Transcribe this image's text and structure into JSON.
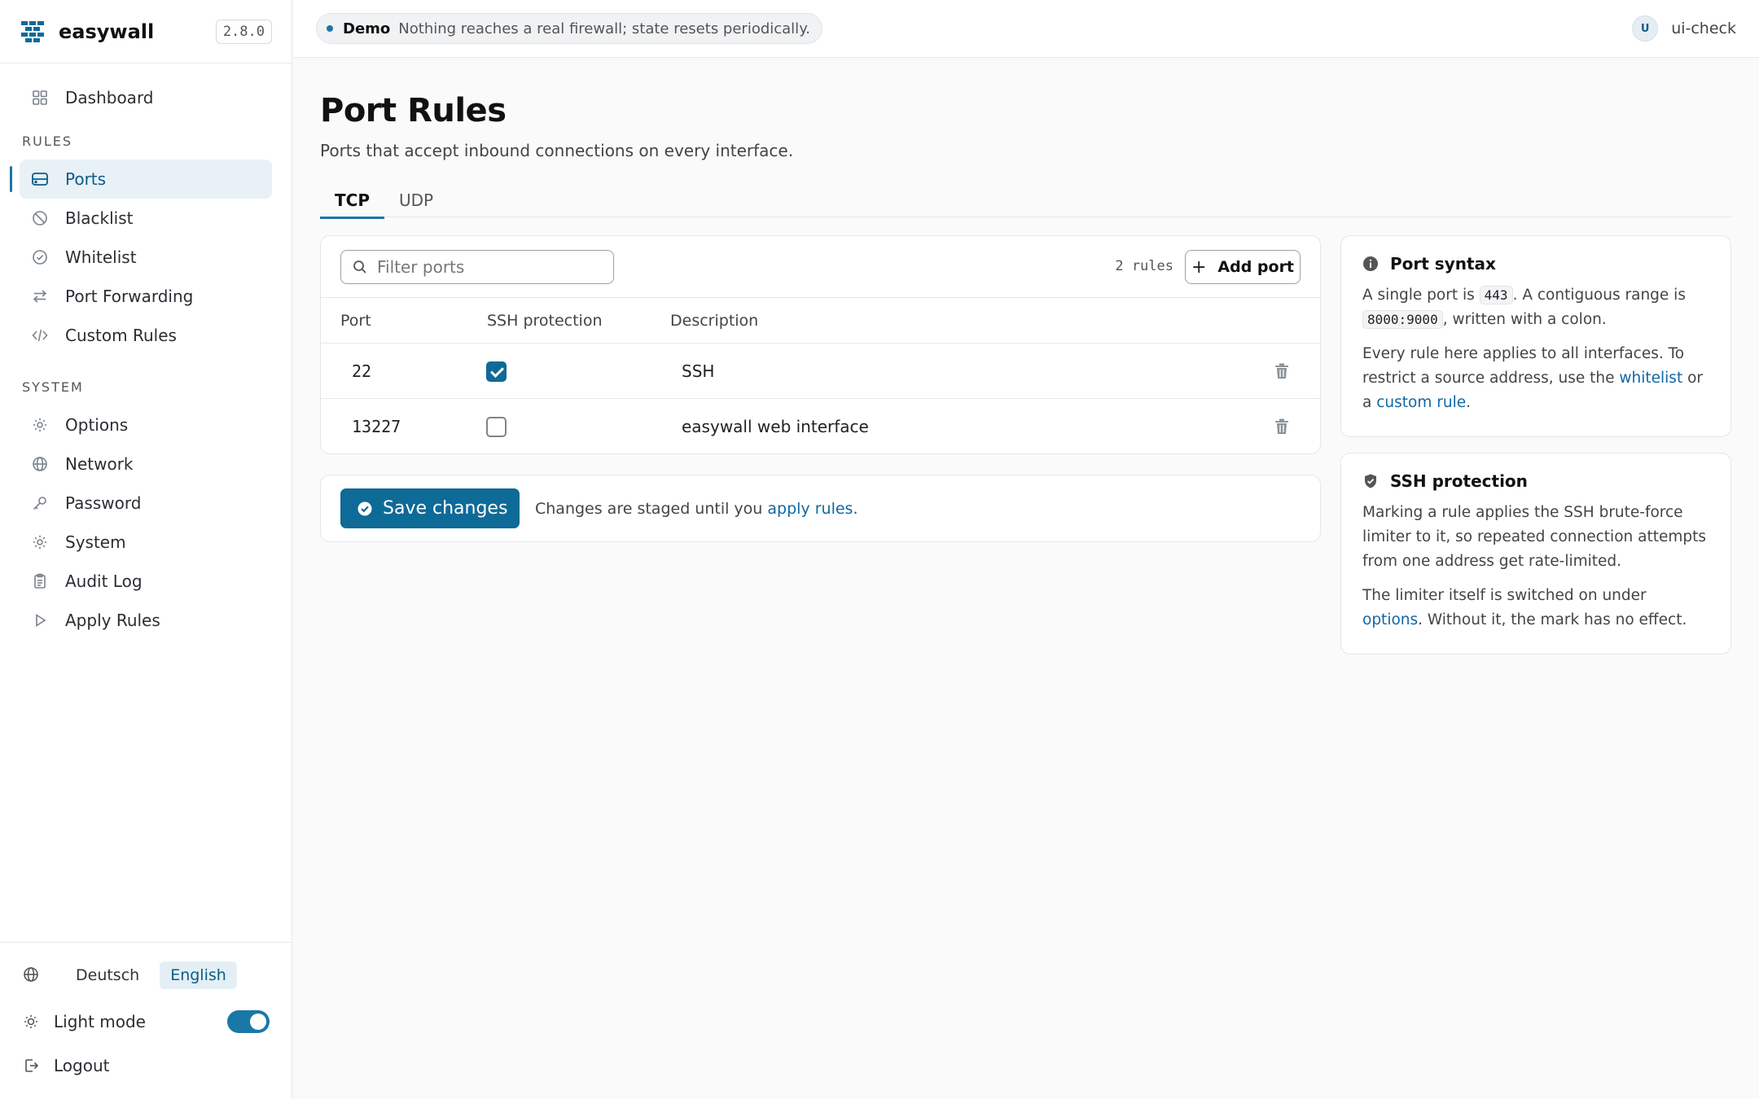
{
  "brand": {
    "name": "easywall",
    "version": "2.8.0"
  },
  "nav": {
    "dashboard": "Dashboard",
    "rules_heading": "RULES",
    "ports": "Ports",
    "blacklist": "Blacklist",
    "whitelist": "Whitelist",
    "port_forwarding": "Port Forwarding",
    "custom_rules": "Custom Rules",
    "system_heading": "SYSTEM",
    "options": "Options",
    "network": "Network",
    "password": "Password",
    "system": "System",
    "audit_log": "Audit Log",
    "apply_rules": "Apply Rules",
    "active": "Ports"
  },
  "footer": {
    "lang_de": "Deutsch",
    "lang_en": "English",
    "selected_lang": "English",
    "light_mode": "Light mode",
    "light_mode_on": true,
    "logout": "Logout"
  },
  "topbar": {
    "demo_title": "Demo",
    "demo_text": "Nothing reaches a real firewall; state resets periodically.",
    "avatar_initial": "U",
    "username": "ui-check"
  },
  "page": {
    "title": "Port Rules",
    "subtitle": "Ports that accept inbound connections on every interface.",
    "tabs": [
      "TCP",
      "UDP"
    ],
    "active_tab": "TCP"
  },
  "rules": {
    "filter_placeholder": "Filter ports",
    "count_label": "2 rules",
    "add_button": "Add port",
    "columns": [
      "Port",
      "SSH protection",
      "Description"
    ],
    "rows": [
      {
        "port": "22",
        "ssh": true,
        "description": "SSH"
      },
      {
        "port": "13227",
        "ssh": false,
        "description": "easywall web interface"
      }
    ]
  },
  "save": {
    "button": "Save changes",
    "note_prefix": "Changes are staged until you",
    "note_link": "apply rules",
    "note_suffix": "."
  },
  "port_syntax": {
    "title": "Port syntax",
    "p1_a": "A single port is",
    "p1_code1": "443",
    "p1_b": ". A contiguous range is",
    "p1_code2": "8000:9000",
    "p1_c": ", written with a colon.",
    "p2_a": "Every rule here applies to all interfaces. To restrict a source address, use the",
    "p2_link1": "whitelist",
    "p2_b": "or a",
    "p2_link2": "custom rule",
    "p2_c": "."
  },
  "ssh_protection": {
    "title": "SSH protection",
    "p1": "Marking a rule applies the SSH brute-force limiter to it, so repeated connection attempts from one address get rate-limited.",
    "p2_a": "The limiter itself is switched on under",
    "p2_link": "options",
    "p2_b": ". Without it, the mark has no effect."
  },
  "colors": {
    "accent": "#0e6a97",
    "link": "#1067a3",
    "active_bg": "#e8f1f6"
  }
}
